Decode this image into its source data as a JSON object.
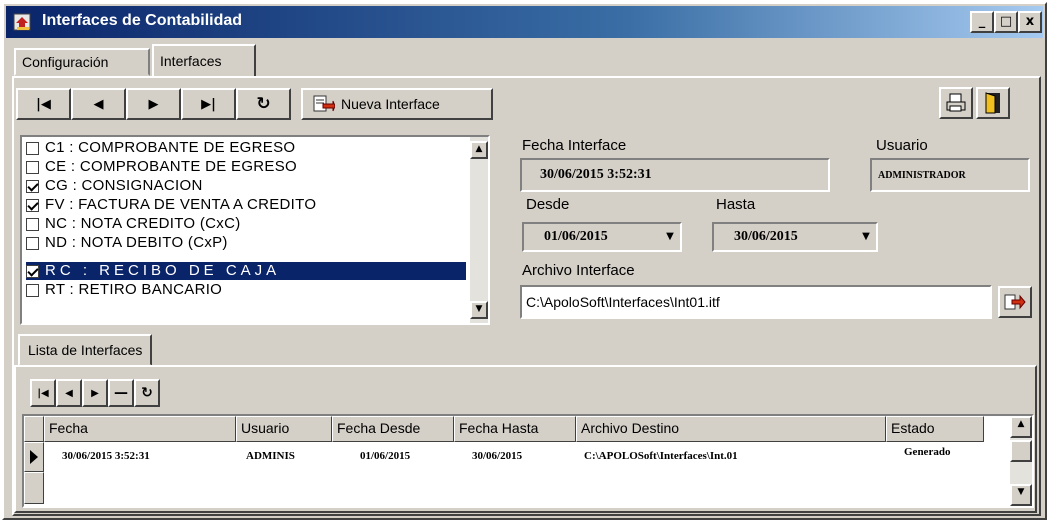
{
  "window": {
    "title": "Interfaces de Contabilidad",
    "controls": [
      "_",
      "□",
      "x"
    ]
  },
  "tabs": [
    {
      "label": "Configuración"
    },
    {
      "label": "Interfaces"
    }
  ],
  "toolbar": {
    "nav": [
      "first",
      "prev",
      "next",
      "last",
      "refresh"
    ],
    "new_interface_label": "Nueva Interface"
  },
  "document_types": [
    {
      "label": "C1 : COMPROBANTE DE EGRESO",
      "checked": false,
      "selected": false
    },
    {
      "label": "CE : COMPROBANTE DE EGRESO",
      "checked": false,
      "selected": false
    },
    {
      "label": "CG : CONSIGNACION",
      "checked": true,
      "selected": false
    },
    {
      "label": "FV : FACTURA DE VENTA A CREDITO",
      "checked": true,
      "selected": false
    },
    {
      "label": "NC : NOTA CREDITO (CxC)",
      "checked": false,
      "selected": false
    },
    {
      "label": "ND : NOTA DEBITO (CxP)",
      "checked": false,
      "selected": false
    },
    {
      "label": "RC : RECIBO DE CAJA",
      "checked": true,
      "selected": true
    },
    {
      "label": "RT : RETIRO BANCARIO",
      "checked": false,
      "selected": false
    }
  ],
  "form": {
    "fecha_interface_label": "Fecha Interface",
    "fecha_interface_value": "30/06/2015   3:52:31",
    "usuario_label": "Usuario",
    "usuario_value": "ADMINISTRADOR",
    "desde_label": "Desde",
    "desde_value": "01/06/2015",
    "hasta_label": "Hasta",
    "hasta_value": "30/06/2015",
    "archivo_label": "Archivo Interface",
    "archivo_value": "C:\\ApoloSoft\\Interfaces\\Int01.itf"
  },
  "lower": {
    "tab_label": "Lista de Interfaces",
    "nav": [
      "first",
      "prev",
      "next",
      "delete",
      "refresh"
    ],
    "columns": [
      "Fecha",
      "Usuario",
      "Fecha Desde",
      "Fecha Hasta",
      "Archivo Destino",
      "Estado"
    ],
    "rows": [
      {
        "fecha": "30/06/2015    3:52:31",
        "usuario": "ADMINIS",
        "fecha_desde": "01/06/2015",
        "fecha_hasta": "30/06/2015",
        "archivo_destino": "C:\\APOLOSoft\\Interfaces\\Int.01",
        "estado": "Generado"
      }
    ]
  }
}
